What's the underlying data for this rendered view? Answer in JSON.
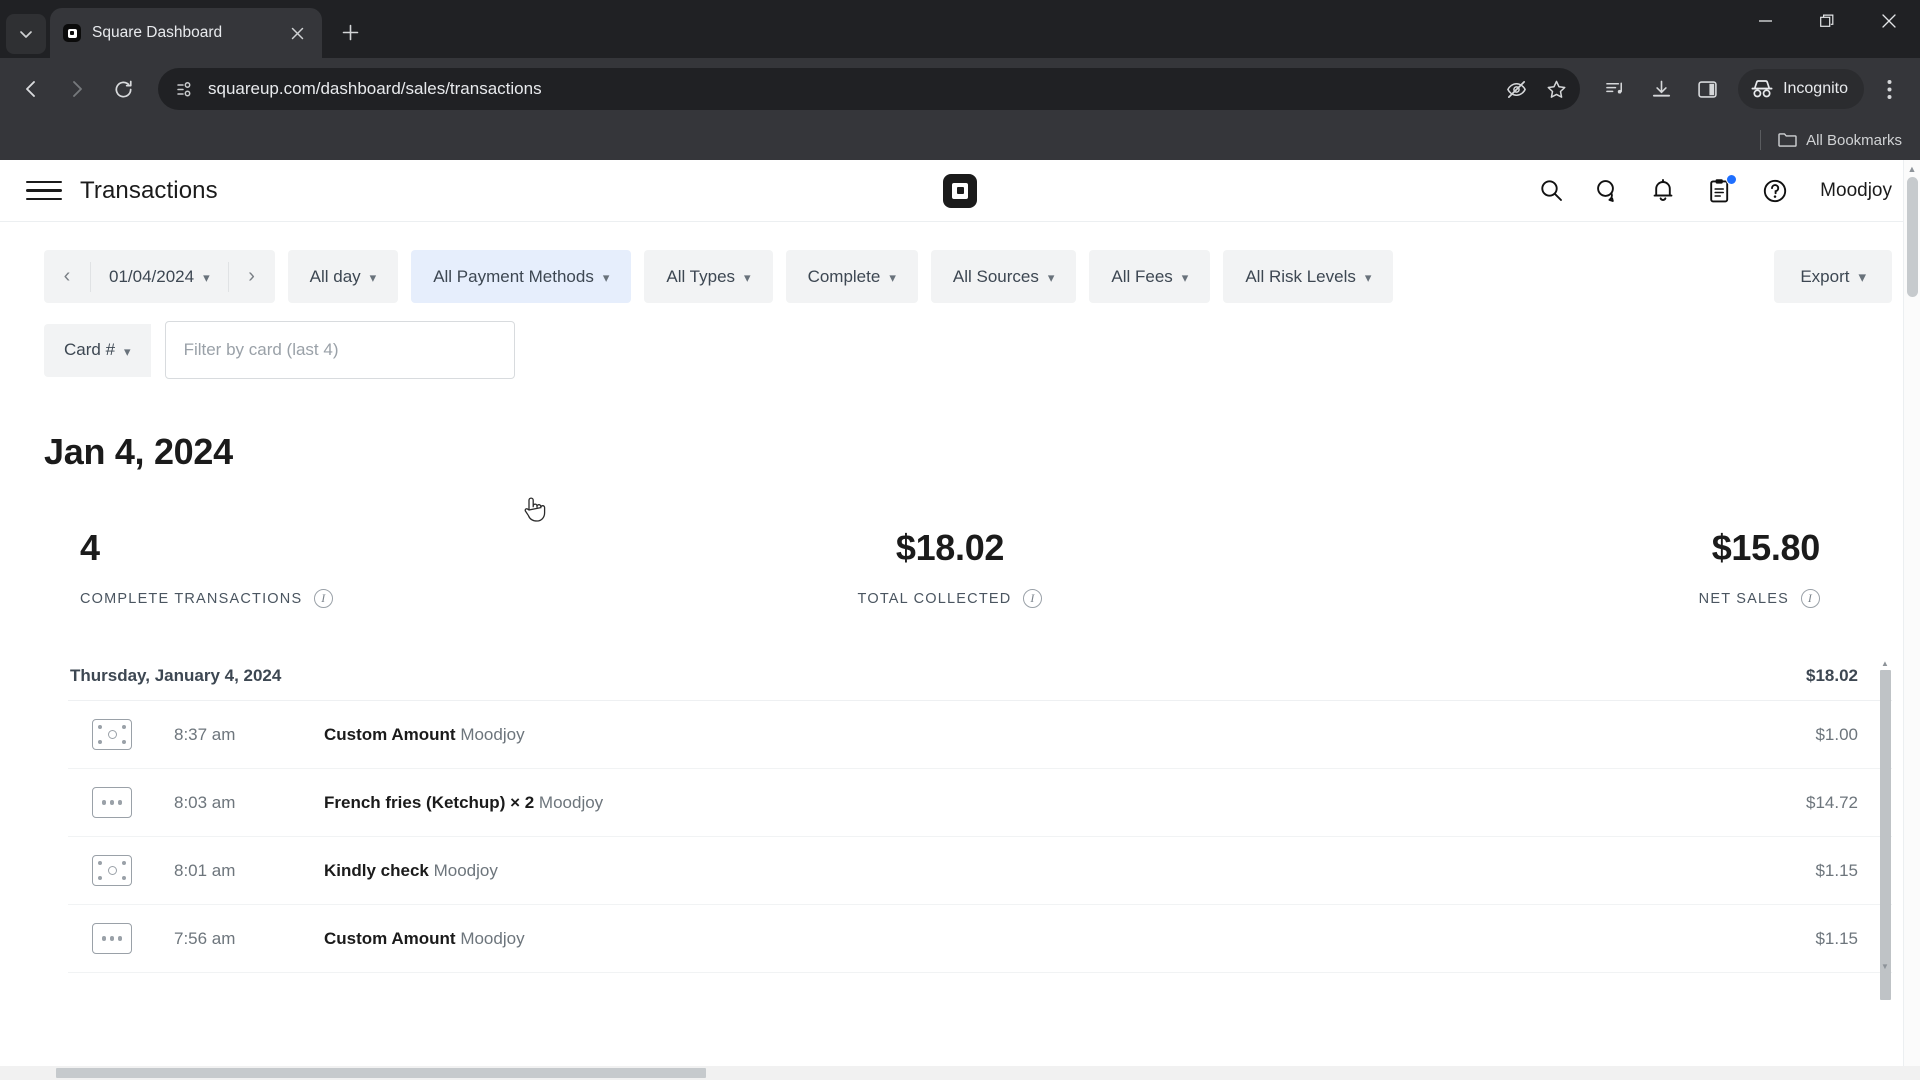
{
  "browser": {
    "tab": {
      "title": "Square Dashboard",
      "favicon": "square-logo-icon"
    },
    "new_tab_label": "+",
    "omnibox": {
      "url": "squareup.com/dashboard/sales/transactions",
      "site_info_icon": "page-info-icon"
    },
    "toolbar_icons": [
      "back-icon",
      "forward-icon",
      "reload-icon",
      "tracking-protection-icon",
      "bookmark-star-icon",
      "reading-list-icon",
      "downloads-icon",
      "side-panel-icon"
    ],
    "incognito_label": "Incognito",
    "menu_icon": "three-dot-menu-icon",
    "bookmarks_bar": {
      "label": "All Bookmarks",
      "icon": "folder-icon"
    },
    "window_controls": [
      "minimize",
      "restore",
      "close"
    ]
  },
  "app": {
    "header": {
      "menu_icon": "hamburger-menu-icon",
      "title": "Transactions",
      "brand_icon": "square-logo-icon",
      "icons": [
        "search-icon",
        "messages-icon",
        "notifications-bell-icon",
        "clipboard-tasks-icon",
        "help-circle-icon"
      ],
      "clipboard_has_badge": true,
      "username": "Moodjoy"
    },
    "filters": {
      "prev_label": "‹",
      "next_label": "›",
      "date": "01/04/2024",
      "buttons": [
        {
          "label": "All day",
          "active": false
        },
        {
          "label": "All Payment Methods",
          "active": true
        },
        {
          "label": "All Types",
          "active": false
        },
        {
          "label": "Complete",
          "active": false
        },
        {
          "label": "All Sources",
          "active": false
        },
        {
          "label": "All Fees",
          "active": false
        },
        {
          "label": "All Risk Levels",
          "active": false
        }
      ],
      "export_label": "Export",
      "card_select_label": "Card #",
      "card_input_placeholder": "Filter by card (last 4)",
      "card_input_value": ""
    },
    "day_title": "Jan 4, 2024",
    "summary": [
      {
        "value": "4",
        "label": "COMPLETE TRANSACTIONS"
      },
      {
        "value": "$18.02",
        "label": "TOTAL COLLECTED"
      },
      {
        "value": "$15.80",
        "label": "NET SALES"
      }
    ],
    "list": {
      "group_header": {
        "label": "Thursday, January 4, 2024",
        "amount": "$18.02"
      },
      "rows": [
        {
          "icon": "cash-payment-icon",
          "time": "8:37 am",
          "title": "Custom Amount",
          "merchant": "Moodjoy",
          "amount": "$1.00"
        },
        {
          "icon": "other-payment-icon",
          "time": "8:03 am",
          "title": "French fries (Ketchup) × 2",
          "merchant": "Moodjoy",
          "amount": "$14.72"
        },
        {
          "icon": "cash-payment-icon",
          "time": "8:01 am",
          "title": "Kindly check",
          "merchant": "Moodjoy",
          "amount": "$1.15"
        },
        {
          "icon": "other-payment-icon",
          "time": "7:56 am",
          "title": "Custom Amount",
          "merchant": "Moodjoy",
          "amount": "$1.15"
        }
      ]
    }
  },
  "colors": {
    "accent_active_filter": "#e6eefc",
    "badge_blue": "#1f6fff",
    "chrome_dark": "#202124",
    "toolbar_dark": "#35363a"
  }
}
